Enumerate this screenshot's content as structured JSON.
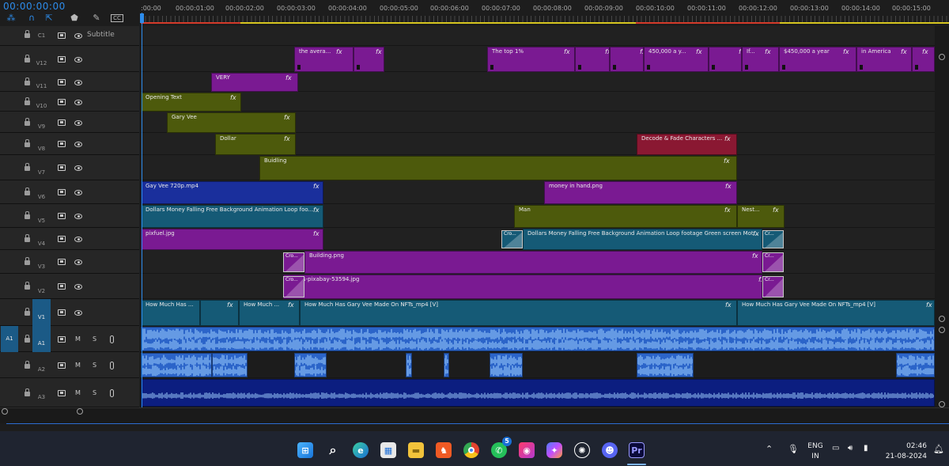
{
  "timecode": "00:00:00:00",
  "colors": {
    "accent": "#2d8ceb",
    "purple": "#7a1a92",
    "olive": "#4d5a0c",
    "navy": "#1a2f9c",
    "teal": "#155a76",
    "crimson": "#8a1832",
    "audio_bright": "#2b64c9",
    "audio_dark": "#0c1e80"
  },
  "ruler": {
    "labels": [
      ":00:00",
      "00:00:01:00",
      "00:00:02:00",
      "00:00:03:00",
      "00:00:04:00",
      "00:00:05:00",
      "00:00:06:00",
      "00:00:07:00",
      "00:00:08:00",
      "00:00:09:00",
      "00:00:10:00",
      "00:00:11:00",
      "00:00:12:00",
      "00:00:13:00",
      "00:00:14:00",
      "00:00:15:00"
    ]
  },
  "subtitle_track": {
    "name": "C1",
    "label": "Subtitle"
  },
  "source_patch": "A1",
  "video_tracks": [
    {
      "name": "V12",
      "clips": [
        {
          "label": "the avera...",
          "fx": [
            "fx"
          ]
        },
        {
          "label": "",
          "fx": [
            "fx"
          ]
        },
        {
          "label": "The top 1%",
          "fx": [
            "fx"
          ]
        },
        {
          "label": "",
          "fx": [
            "fx"
          ]
        },
        {
          "label": "",
          "fx": [
            "fx"
          ]
        },
        {
          "label": "450,000 a y...",
          "fx": [
            "fx"
          ]
        },
        {
          "label": "",
          "fx": [
            "fx"
          ]
        },
        {
          "label": "If...",
          "fx": [
            "fx"
          ]
        },
        {
          "label": "$450,000 a year",
          "fx": [
            "fx"
          ]
        },
        {
          "label": "in America",
          "fx": [
            "fx"
          ]
        },
        {
          "label": "",
          "fx": [
            "fx"
          ]
        }
      ]
    },
    {
      "name": "V11",
      "clips": [
        {
          "label": "VERY",
          "fx": [
            "fx"
          ]
        }
      ]
    },
    {
      "name": "V10",
      "clips": [
        {
          "label": "Opening Text",
          "fx": [
            "fx"
          ]
        }
      ]
    },
    {
      "name": "V9",
      "clips": [
        {
          "label": "Gary Vee",
          "fx": [
            "fx"
          ]
        }
      ]
    },
    {
      "name": "V8",
      "clips": [
        {
          "label": "Dollar",
          "fx": [
            "fx"
          ]
        },
        {
          "label": "Decode & Fade Characters ...",
          "fx": [
            "fx"
          ]
        }
      ]
    },
    {
      "name": "V7",
      "clips": [
        {
          "label": "Buidling",
          "fx": [
            "fx"
          ]
        }
      ]
    },
    {
      "name": "V6",
      "clips": [
        {
          "label": "Gay Vee 720p.mp4",
          "fx": [
            "fx"
          ]
        },
        {
          "label": "money in hand.png",
          "fx": [
            "fx"
          ]
        }
      ]
    },
    {
      "name": "V5",
      "clips": [
        {
          "label": "Dollars Money Falling Free Background Animation Loop foo...",
          "fx": [
            "fx"
          ]
        },
        {
          "label": "Man",
          "fx": [
            "fx"
          ]
        },
        {
          "label": "Nest...",
          "fx": [
            "fx"
          ]
        }
      ]
    },
    {
      "name": "V4",
      "clips": [
        {
          "label": "pixfuel.jpg",
          "fx": [
            "fx"
          ]
        },
        {
          "label": "Cro...",
          "fx": []
        },
        {
          "label": "Dollars Money Falling Free Background Animation Loop footage Green screen Mot...",
          "fx": [
            "fx"
          ]
        },
        {
          "label": "Cr...",
          "fx": []
        }
      ]
    },
    {
      "name": "V3",
      "clips": [
        {
          "label": "Cro...",
          "fx": []
        },
        {
          "label": "Building.png",
          "fx": [
            "fx"
          ]
        },
        {
          "label": "Cr...",
          "fx": []
        }
      ]
    },
    {
      "name": "V2",
      "clips": [
        {
          "label": "pexels-pixabay-53594.jpg",
          "fx": [
            "fx"
          ]
        },
        {
          "label": "Cro...",
          "fx": []
        },
        {
          "label": "Cr...",
          "fx": []
        }
      ]
    },
    {
      "name": "V1",
      "clips": [
        {
          "label": "How Much Has ...",
          "fx": [
            "fx"
          ]
        },
        {
          "label": "",
          "fx": [
            "fx"
          ]
        },
        {
          "label": "How Much ...",
          "fx": [
            "fx"
          ]
        },
        {
          "label": "How Much Has Gary Vee Made On NFTs_mp4 [V]",
          "fx": [
            "fx"
          ]
        },
        {
          "label": "How Much Has Gary Vee Made On NFTs_mp4 [V]",
          "fx": [
            "fx"
          ]
        }
      ]
    }
  ],
  "audio_tracks": [
    {
      "name": "A1",
      "m": "M",
      "s": "S"
    },
    {
      "name": "A2",
      "m": "M",
      "s": "S"
    },
    {
      "name": "A3",
      "m": "M",
      "s": "S"
    }
  ],
  "taskbar": {
    "apps": [
      "windows-start",
      "search",
      "edge",
      "store",
      "file-explorer",
      "brave",
      "chrome",
      "whatsapp",
      "photo-editor",
      "copilot",
      "openai",
      "discord",
      "premiere-pro"
    ],
    "whatsapp_badge": "5",
    "premiere_label": "Pr",
    "language_top": "ENG",
    "language_bottom": "IN",
    "time": "02:46",
    "date": "21-08-2024"
  }
}
